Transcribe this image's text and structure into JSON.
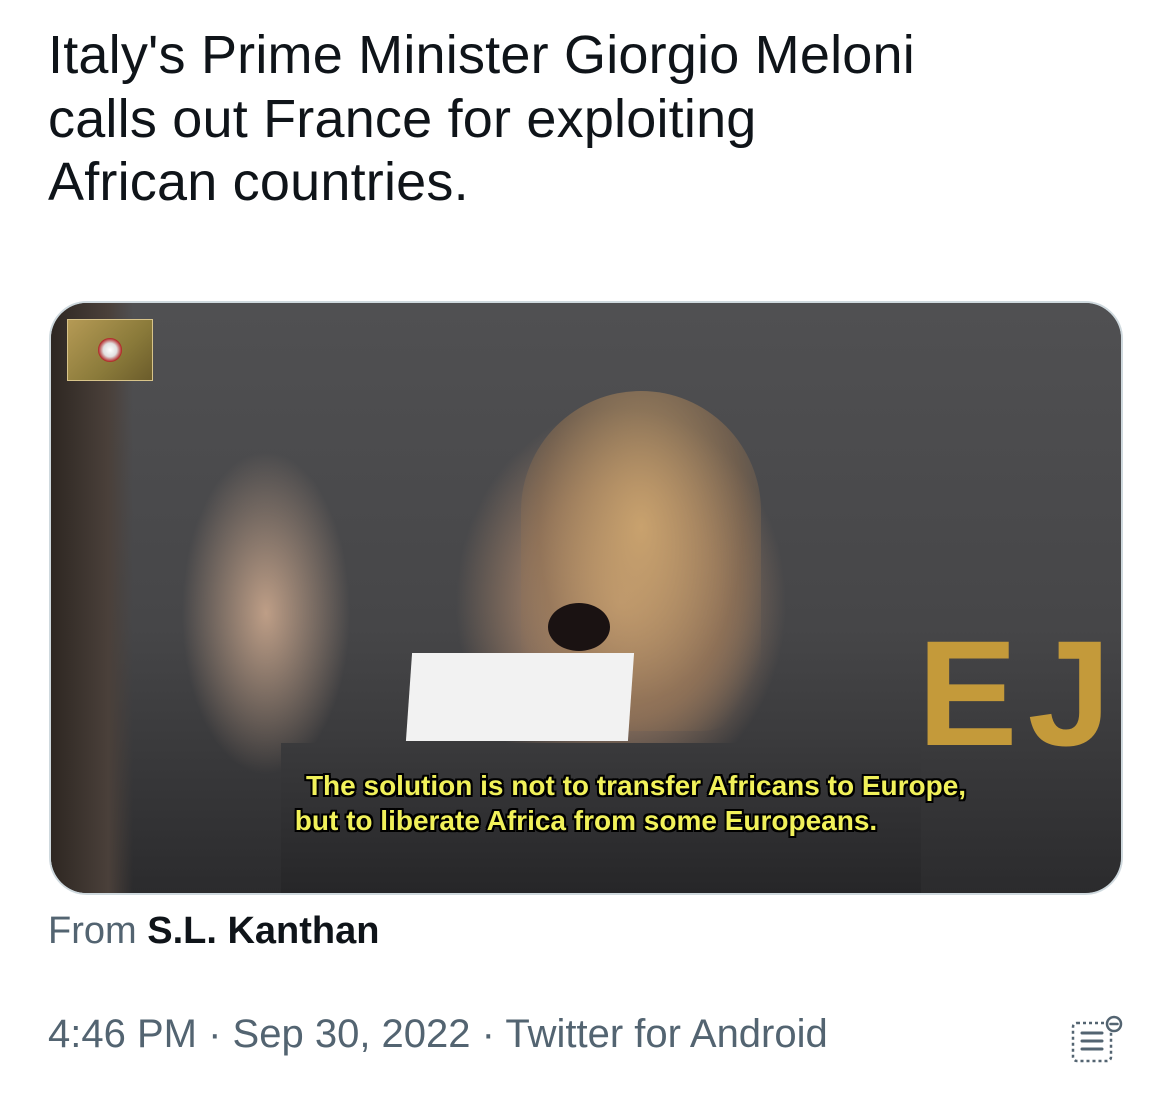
{
  "tweet": {
    "text_lines": [
      "Italy's Prime Minister Giorgio Meloni",
      "calls out France for exploiting",
      "African countries."
    ]
  },
  "media": {
    "subtitle_lines": [
      "The solution is not to transfer Africans to Europe,",
      "but to liberate Africa from some Europeans."
    ],
    "background_letters": "EJ"
  },
  "source": {
    "prefix": "From",
    "author": "S.L. Kanthan"
  },
  "meta": {
    "time": "4:46 PM",
    "separator": "·",
    "date": "Sep 30, 2022",
    "client": "Twitter for Android"
  },
  "icons": {
    "analytics": "analytics-icon"
  },
  "colors": {
    "text_primary": "#0f1419",
    "text_secondary": "#536471",
    "card_border": "#cfd9de",
    "subtitle": "#f1f15a"
  }
}
